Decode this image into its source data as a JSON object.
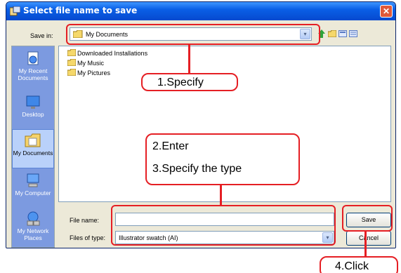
{
  "dialog": {
    "title": "Select file name to save",
    "close_glyph": "✕"
  },
  "save_in": {
    "label": "Save in:",
    "value": "My Documents",
    "arrow_glyph": "▾"
  },
  "toolbar_icons": [
    "back-icon",
    "up-folder-icon",
    "new-folder-icon",
    "view-menu-icon"
  ],
  "places": [
    {
      "label": "My Recent Documents",
      "icon": "recent-documents-icon"
    },
    {
      "label": "Desktop",
      "icon": "desktop-icon"
    },
    {
      "label": "My Documents",
      "icon": "my-documents-icon"
    },
    {
      "label": "My Computer",
      "icon": "my-computer-icon"
    },
    {
      "label": "My Network Places",
      "icon": "network-places-icon"
    }
  ],
  "files": [
    {
      "name": "Downloaded Installations"
    },
    {
      "name": "My Music"
    },
    {
      "name": "My Pictures"
    }
  ],
  "file_name": {
    "label": "File name:",
    "value": ""
  },
  "file_type": {
    "label": "Files of type:",
    "value": "Illustrator swatch (AI)",
    "arrow_glyph": "▾"
  },
  "buttons": {
    "save": "Save",
    "cancel": "Cancel"
  },
  "callouts": {
    "specify": "1.Specify",
    "enter": "2.Enter",
    "type": "3.Specify the type",
    "click": "4.Click"
  },
  "colors": {
    "annotation_red": "#e51f24",
    "titlebar_blue": "#0a5fe6",
    "places_bar": "#7c9ae0"
  }
}
